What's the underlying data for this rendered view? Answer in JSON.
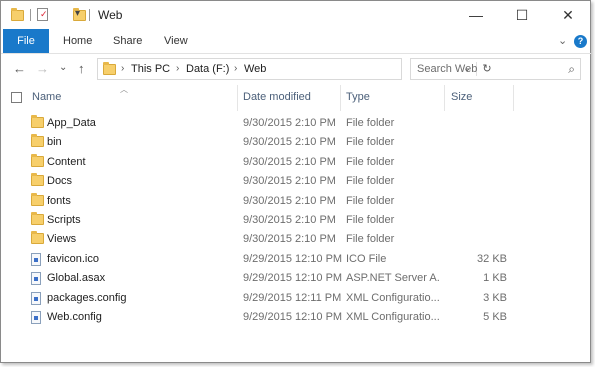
{
  "window": {
    "title": "Web",
    "minimize_glyph": "—",
    "maximize_glyph": "☐",
    "close_glyph": "✕"
  },
  "ribbon": {
    "file": "File",
    "tabs": [
      "Home",
      "Share",
      "View"
    ],
    "collapse_glyph": "⌄",
    "help_glyph": "?"
  },
  "nav": {
    "back_glyph": "←",
    "forward_glyph": "→",
    "recent_glyph": "⌄",
    "up_glyph": "↑",
    "breadcrumb": [
      "This PC",
      "Data (F:)",
      "Web"
    ],
    "crumb_sep": "›",
    "dropdown_glyph": "⌄",
    "refresh_glyph": "↻",
    "search_placeholder": "Search Web",
    "search_glyph": "⌕"
  },
  "columns": {
    "name": "Name",
    "date": "Date modified",
    "type": "Type",
    "size": "Size",
    "sort_glyph": "︿"
  },
  "files": [
    {
      "name": "App_Data",
      "date": "9/30/2015 2:10 PM",
      "type": "File folder",
      "size": "",
      "icon": "folder-icon"
    },
    {
      "name": "bin",
      "date": "9/30/2015 2:10 PM",
      "type": "File folder",
      "size": "",
      "icon": "folder-icon"
    },
    {
      "name": "Content",
      "date": "9/30/2015 2:10 PM",
      "type": "File folder",
      "size": "",
      "icon": "folder-icon"
    },
    {
      "name": "Docs",
      "date": "9/30/2015 2:10 PM",
      "type": "File folder",
      "size": "",
      "icon": "folder-icon"
    },
    {
      "name": "fonts",
      "date": "9/30/2015 2:10 PM",
      "type": "File folder",
      "size": "",
      "icon": "folder-icon"
    },
    {
      "name": "Scripts",
      "date": "9/30/2015 2:10 PM",
      "type": "File folder",
      "size": "",
      "icon": "folder-icon"
    },
    {
      "name": "Views",
      "date": "9/30/2015 2:10 PM",
      "type": "File folder",
      "size": "",
      "icon": "folder-icon"
    },
    {
      "name": "favicon.ico",
      "date": "9/29/2015 12:10 PM",
      "type": "ICO File",
      "size": "32 KB",
      "icon": "file-icon"
    },
    {
      "name": "Global.asax",
      "date": "9/29/2015 12:10 PM",
      "type": "ASP.NET Server A...",
      "size": "1 KB",
      "icon": "file-icon"
    },
    {
      "name": "packages.config",
      "date": "9/29/2015 12:11 PM",
      "type": "XML Configuratio...",
      "size": "3 KB",
      "icon": "file-icon"
    },
    {
      "name": "Web.config",
      "date": "9/29/2015 12:10 PM",
      "type": "XML Configuratio...",
      "size": "5 KB",
      "icon": "file-icon"
    }
  ],
  "colors": {
    "accent": "#1979ca",
    "folder": "#f7cf6b",
    "header_text": "#4c607a"
  }
}
